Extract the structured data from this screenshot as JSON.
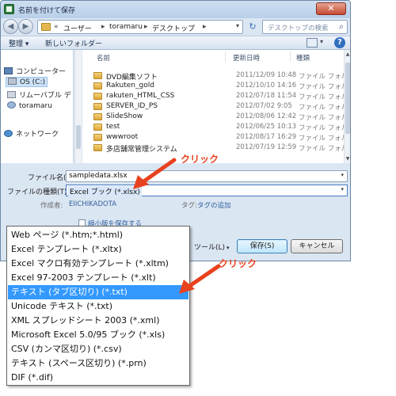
{
  "window": {
    "title": "名前を付けて保存",
    "close_glyph": "✕"
  },
  "nav": {
    "back_glyph": "◀",
    "forward_glyph": "▶",
    "breadcrumb": [
      "ユーザー",
      "toramaru",
      "デスクトップ"
    ],
    "breadcrumb_prefix": "«",
    "separator": "▸",
    "refresh_glyph": "↻",
    "search_placeholder": "デスクトップの検索",
    "search_icon": "search-icon"
  },
  "toolbar": {
    "organize": "整理 ▾",
    "new_folder": "新しいフォルダー",
    "help_glyph": "?"
  },
  "sidebar": {
    "items": [
      {
        "label": "コンピューター",
        "icon": "computer-icon"
      },
      {
        "label": "OS (C:)",
        "icon": "drive-icon"
      },
      {
        "label": "リムーバブル デ",
        "icon": "removable-drive-icon"
      },
      {
        "label": "toramaru",
        "icon": "user-icon"
      },
      {
        "label": "ネットワーク",
        "icon": "network-icon"
      }
    ]
  },
  "file_list": {
    "columns": [
      "名前",
      "更新日時",
      "種類"
    ],
    "rows": [
      {
        "name": "DVD編集ソフト",
        "date": "2011/12/09 10:48",
        "type": "ファイル フォル"
      },
      {
        "name": "Rakuten_gold",
        "date": "2012/10/10 14:16",
        "type": "ファイル フォル"
      },
      {
        "name": "rakuten_HTML_CSS",
        "date": "2012/07/18 11:54",
        "type": "ファイル フォル"
      },
      {
        "name": "SERVER_ID_PS",
        "date": "2012/07/02 9:05",
        "type": "ファイル フォル"
      },
      {
        "name": "SlideShow",
        "date": "2012/08/06 12:42",
        "type": "ファイル フォル"
      },
      {
        "name": "test",
        "date": "2012/06/25 10:13",
        "type": "ファイル フォル"
      },
      {
        "name": "wwwroot",
        "date": "2012/08/17 16:29",
        "type": "ファイル フォル"
      },
      {
        "name": "多店舗常管理システム",
        "date": "2012/07/19 12:59",
        "type": "ファイル フォル"
      }
    ]
  },
  "form": {
    "filename_label": "ファイル名(N):",
    "filename_value": "sampledata.xlsx",
    "filetype_label": "ファイルの種類(T):",
    "filetype_value": "Excel ブック (*.xlsx)",
    "author_label": "作成者:",
    "author_value": "EIICHIKADOTA",
    "tag_label": "タグ:",
    "tag_value": "タグの追加",
    "thumbnail_label": "縮小版を保存する",
    "dropdown_glyph": "▾"
  },
  "buttons": {
    "tools": "ツール(L)",
    "save": "保存(S)",
    "cancel": "キャンセル"
  },
  "filetype_options": [
    "Web ページ (*.htm;*.html)",
    "Excel テンプレート (*.xltx)",
    "Excel マクロ有効テンプレート (*.xltm)",
    "Excel 97-2003 テンプレート (*.xlt)",
    "テキスト (タブ区切り) (*.txt)",
    "Unicode テキスト (*.txt)",
    "XML スプレッドシート 2003 (*.xml)",
    "Microsoft Excel 5.0/95 ブック (*.xls)",
    "CSV (カンマ区切り) (*.csv)",
    "テキスト (スペース区切り) (*.prn)",
    "DIF (*.dif)"
  ],
  "filetype_selected_index": 4,
  "annotations": {
    "click_label_1": "クリック",
    "click_label_2": "クリック",
    "arrow_color": "#e8411e"
  }
}
